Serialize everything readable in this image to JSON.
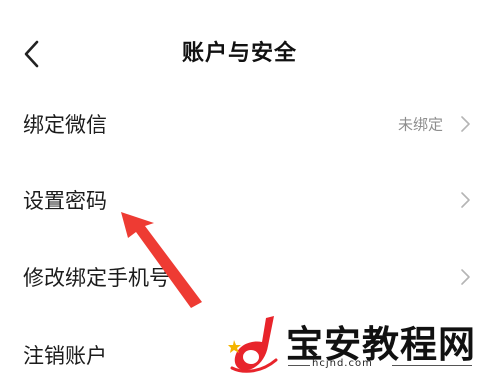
{
  "header": {
    "title": "账户与安全",
    "back_icon": "chevron-left-icon"
  },
  "rows": [
    {
      "label": "绑定微信",
      "value": "未绑定"
    },
    {
      "label": "设置密码",
      "value": ""
    },
    {
      "label": "修改绑定手机号",
      "value": ""
    },
    {
      "label": "注销账户",
      "value": ""
    }
  ],
  "annotation": {
    "arrow_color": "#ee3b33"
  },
  "watermark": {
    "name": "宝安教程网",
    "url": "hcjhd.com",
    "accent_color": "#e8242b"
  }
}
